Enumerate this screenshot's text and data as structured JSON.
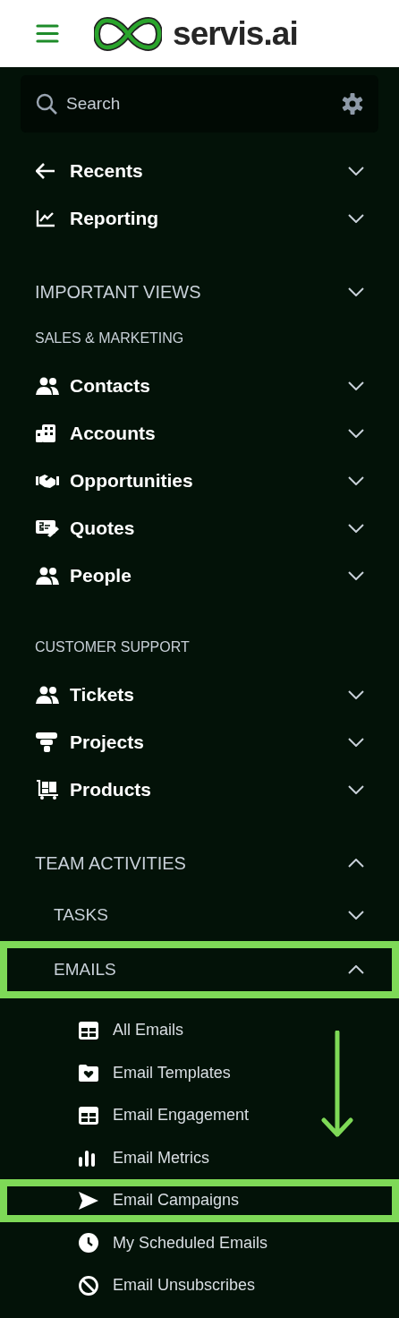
{
  "header": {
    "logo_text": "servis.ai"
  },
  "search": {
    "placeholder": "Search"
  },
  "top_items": [
    {
      "label": "Recents",
      "expanded": false
    },
    {
      "label": "Reporting",
      "expanded": false
    }
  ],
  "important_views": {
    "title": "IMPORTANT VIEWS",
    "expanded": false,
    "groups": [
      {
        "title": "SALES & MARKETING",
        "items": [
          {
            "label": "Contacts",
            "expanded": false
          },
          {
            "label": "Accounts",
            "expanded": false
          },
          {
            "label": "Opportunities",
            "expanded": false
          },
          {
            "label": "Quotes",
            "expanded": false
          },
          {
            "label": "People",
            "expanded": false
          }
        ]
      },
      {
        "title": "CUSTOMER SUPPORT",
        "items": [
          {
            "label": "Tickets",
            "expanded": false
          },
          {
            "label": "Projects",
            "expanded": false
          },
          {
            "label": "Products",
            "expanded": false
          }
        ]
      }
    ]
  },
  "team_activities": {
    "title": "TEAM ACTIVITIES",
    "expanded": true,
    "subsections": [
      {
        "title": "TASKS",
        "expanded": false,
        "highlighted": false
      },
      {
        "title": "EMAILS",
        "expanded": true,
        "highlighted": true,
        "children": [
          {
            "label": "All Emails",
            "highlighted": false
          },
          {
            "label": "Email Templates",
            "highlighted": false
          },
          {
            "label": "Email Engagement",
            "highlighted": false
          },
          {
            "label": "Email Metrics",
            "highlighted": false
          },
          {
            "label": "Email Campaigns",
            "highlighted": true
          },
          {
            "label": "My Scheduled Emails",
            "highlighted": false
          },
          {
            "label": "Email Unsubscribes",
            "highlighted": false
          }
        ]
      }
    ]
  }
}
